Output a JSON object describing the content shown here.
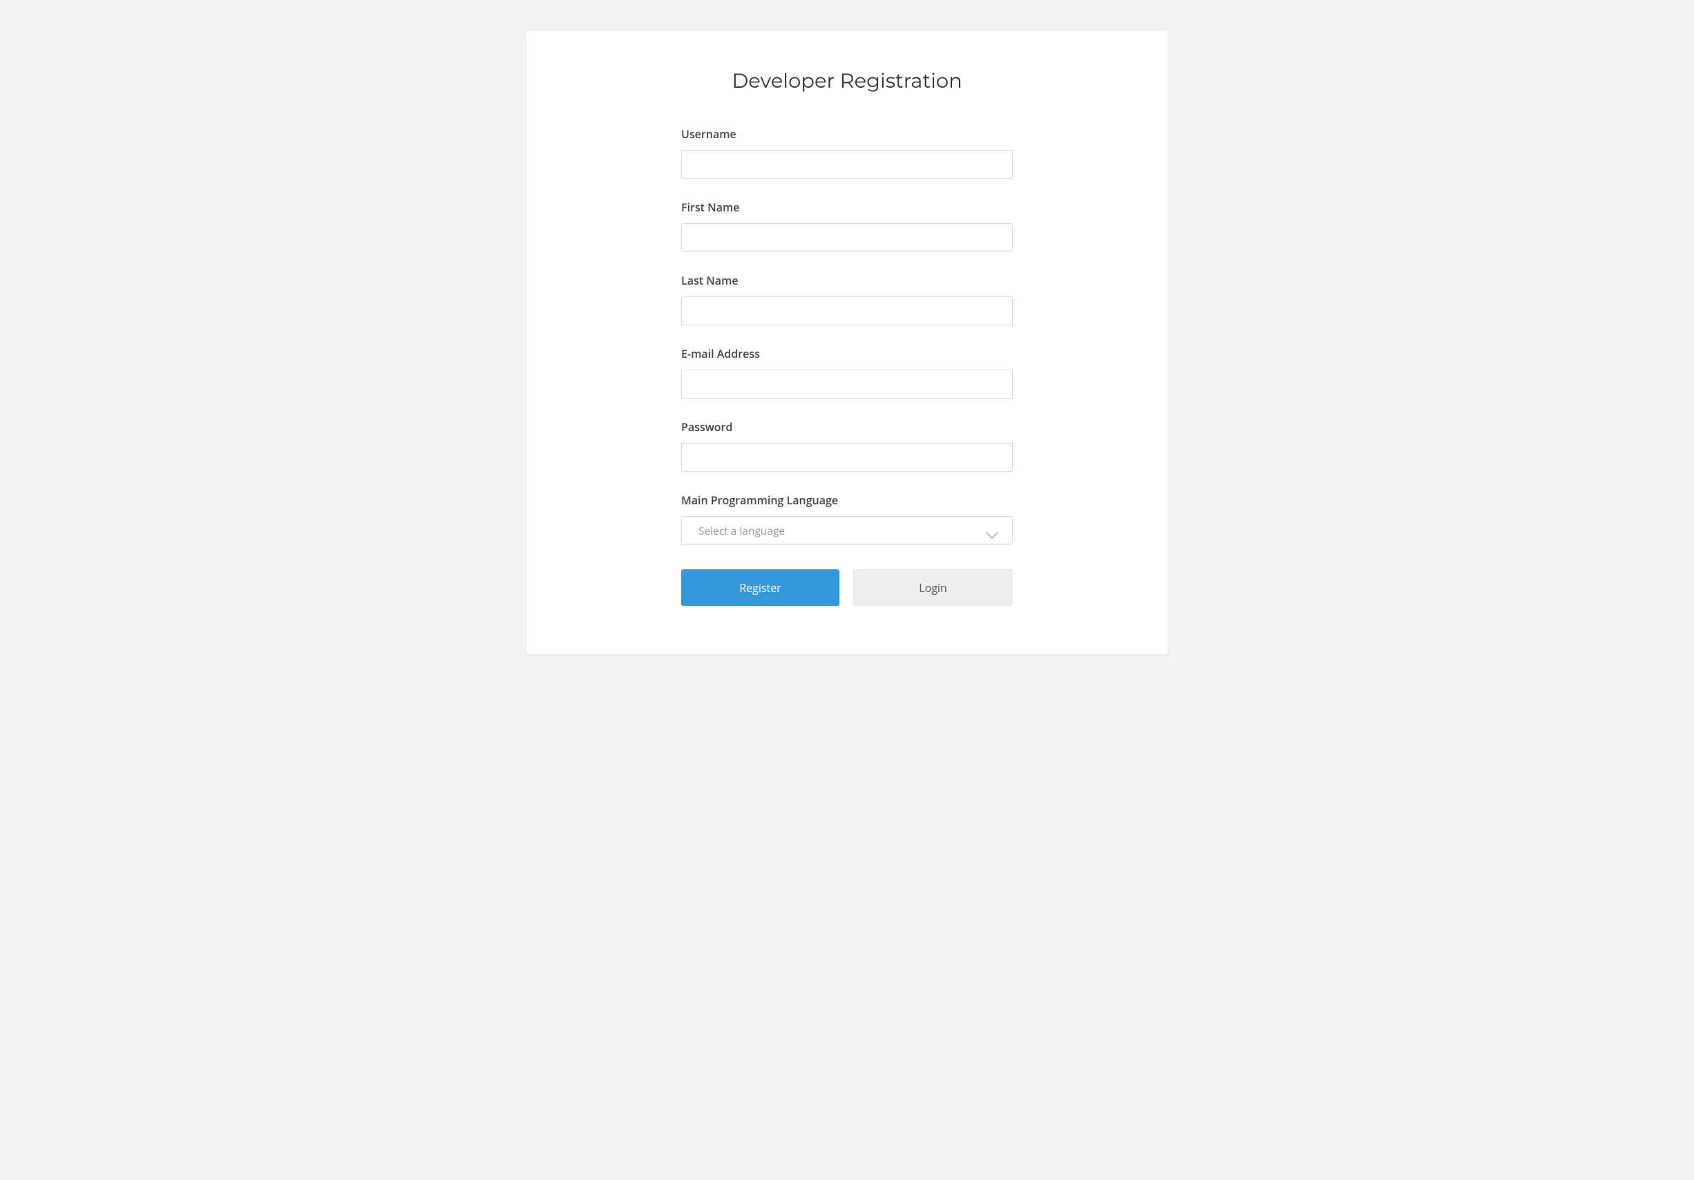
{
  "title": "Developer Registration",
  "fields": {
    "username": {
      "label": "Username",
      "value": ""
    },
    "first_name": {
      "label": "First Name",
      "value": ""
    },
    "last_name": {
      "label": "Last Name",
      "value": ""
    },
    "email": {
      "label": "E-mail Address",
      "value": ""
    },
    "password": {
      "label": "Password",
      "value": ""
    },
    "language": {
      "label": "Main Programming Language",
      "placeholder": "Select a language"
    }
  },
  "buttons": {
    "register": "Register",
    "login": "Login"
  }
}
